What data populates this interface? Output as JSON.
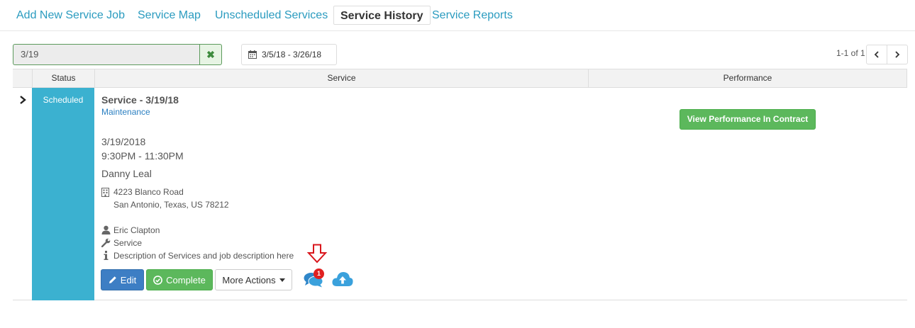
{
  "nav": {
    "tabs": [
      {
        "label": "Add New Service Job"
      },
      {
        "label": "Service Map"
      },
      {
        "label": "Unscheduled Services"
      },
      {
        "label": "Service History",
        "active": true
      },
      {
        "label": "Service Reports"
      }
    ]
  },
  "toolbar": {
    "search_value": "3/19",
    "date_range": "3/5/18 - 3/26/18",
    "pager_text": "1-1 of 1"
  },
  "table": {
    "headers": {
      "status": "Status",
      "service": "Service",
      "performance": "Performance"
    },
    "row": {
      "status": "Scheduled",
      "status_color": "#3bb1d0",
      "title": "Service - 3/19/18",
      "type": "Maintenance",
      "date": "3/19/2018",
      "time": "9:30PM - 11:30PM",
      "customer": "Danny Leal",
      "address_line1": "4223 Blanco Road",
      "address_line2": "San Antonio, Texas, US 78212",
      "technician": "Eric Clapton",
      "job_type": "Service",
      "description": "Description of Services and job description here",
      "actions": {
        "edit": "Edit",
        "complete": "Complete",
        "more": "More Actions"
      },
      "chat_badge_count": "1",
      "performance_button": "View Performance In Contract"
    }
  },
  "colors": {
    "accent": "#2a9bbf",
    "success": "#5cb85c",
    "primary": "#3d7ec4",
    "annotation": "#d9161c"
  }
}
